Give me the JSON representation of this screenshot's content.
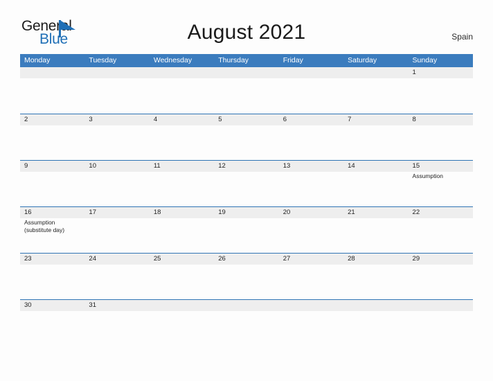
{
  "brand": {
    "name_part1": "General",
    "name_part2": "Blue",
    "logo_icon": "flag-triangle-icon",
    "color_primary": "#1f6fb6"
  },
  "header": {
    "title": "August 2021",
    "country": "Spain"
  },
  "calendar": {
    "header_bg": "#3b7cbe",
    "band_bg": "#eeeeee",
    "row_rule_color": "#2f74b5",
    "weekdays": [
      "Monday",
      "Tuesday",
      "Wednesday",
      "Thursday",
      "Friday",
      "Saturday",
      "Sunday"
    ],
    "weeks": [
      {
        "days": [
          {
            "number": "",
            "events": []
          },
          {
            "number": "",
            "events": []
          },
          {
            "number": "",
            "events": []
          },
          {
            "number": "",
            "events": []
          },
          {
            "number": "",
            "events": []
          },
          {
            "number": "",
            "events": []
          },
          {
            "number": "1",
            "events": []
          }
        ]
      },
      {
        "days": [
          {
            "number": "2",
            "events": []
          },
          {
            "number": "3",
            "events": []
          },
          {
            "number": "4",
            "events": []
          },
          {
            "number": "5",
            "events": []
          },
          {
            "number": "6",
            "events": []
          },
          {
            "number": "7",
            "events": []
          },
          {
            "number": "8",
            "events": []
          }
        ]
      },
      {
        "days": [
          {
            "number": "9",
            "events": []
          },
          {
            "number": "10",
            "events": []
          },
          {
            "number": "11",
            "events": []
          },
          {
            "number": "12",
            "events": []
          },
          {
            "number": "13",
            "events": []
          },
          {
            "number": "14",
            "events": []
          },
          {
            "number": "15",
            "events": [
              "Assumption"
            ]
          }
        ]
      },
      {
        "days": [
          {
            "number": "16",
            "events": [
              "Assumption",
              "(substitute day)"
            ]
          },
          {
            "number": "17",
            "events": []
          },
          {
            "number": "18",
            "events": []
          },
          {
            "number": "19",
            "events": []
          },
          {
            "number": "20",
            "events": []
          },
          {
            "number": "21",
            "events": []
          },
          {
            "number": "22",
            "events": []
          }
        ]
      },
      {
        "days": [
          {
            "number": "23",
            "events": []
          },
          {
            "number": "24",
            "events": []
          },
          {
            "number": "25",
            "events": []
          },
          {
            "number": "26",
            "events": []
          },
          {
            "number": "27",
            "events": []
          },
          {
            "number": "28",
            "events": []
          },
          {
            "number": "29",
            "events": []
          }
        ]
      },
      {
        "days": [
          {
            "number": "30",
            "events": []
          },
          {
            "number": "31",
            "events": []
          },
          {
            "number": "",
            "events": []
          },
          {
            "number": "",
            "events": []
          },
          {
            "number": "",
            "events": []
          },
          {
            "number": "",
            "events": []
          },
          {
            "number": "",
            "events": []
          }
        ]
      }
    ]
  }
}
